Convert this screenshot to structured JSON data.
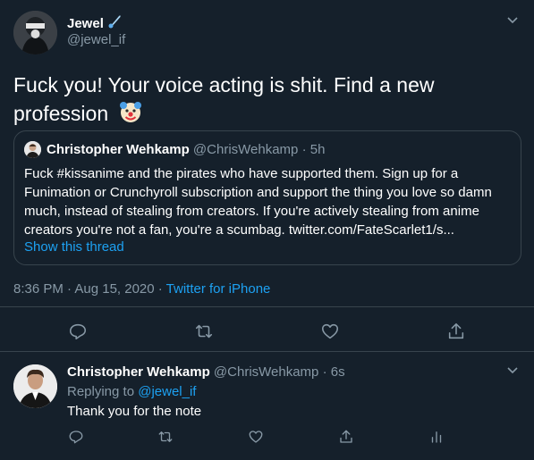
{
  "main_tweet": {
    "author_name": "Jewel",
    "author_handle": "@jewel_if",
    "text": "Fuck you! Your voice acting is shit. Find a new profession",
    "timestamp": "8:36 PM · Aug 15, 2020 · ",
    "source": "Twitter for iPhone"
  },
  "quoted_tweet": {
    "author_name": "Christopher Wehkamp",
    "meta": " @ChrisWehkamp · 5h",
    "text": "Fuck #kissanime and the pirates who have supported them. Sign up for a Funimation or Crunchyroll subscription and support the thing you love so damn much, instead of stealing from creators. If you're actively stealing from anime creators you're not a fan, you're a scumbag. twitter.com/FateScarlet1/s...",
    "show_thread": "Show this thread"
  },
  "reply_tweet": {
    "author_name": "Christopher Wehkamp",
    "meta": " @ChrisWehkamp · 6s",
    "replying_prefix": "Replying to ",
    "replying_mention": "@jewel_if",
    "text": "Thank you for the note"
  },
  "colors": {
    "background": "#15202b",
    "text": "#ffffff",
    "secondary": "#8899a6",
    "accent": "#1da1f2",
    "border": "#38444d"
  },
  "icons": [
    "chevron-down-icon",
    "reply-icon",
    "retweet-icon",
    "like-icon",
    "share-icon",
    "analytics-icon",
    "clown-emoji-icon",
    "comet-emoji-icon"
  ]
}
